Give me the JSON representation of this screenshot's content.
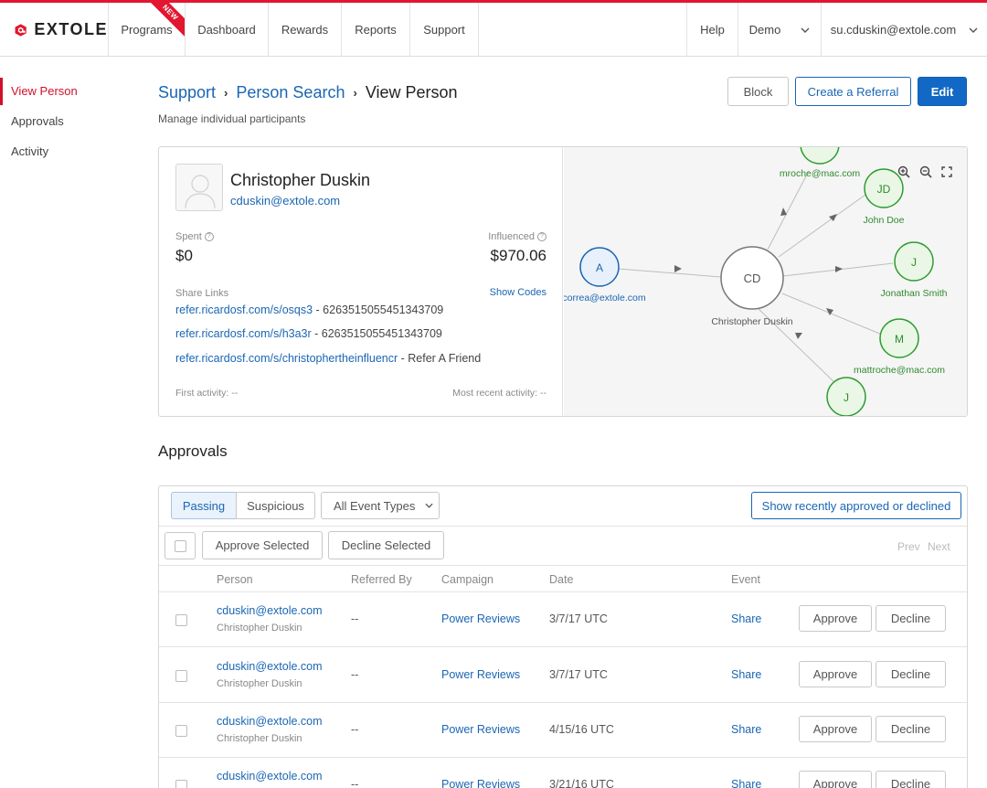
{
  "brand": {
    "name": "EXTOLE",
    "accent": "#e2162f",
    "link": "#1a66b3"
  },
  "nav": {
    "programs": "Programs",
    "new_badge": "NEW",
    "dashboard": "Dashboard",
    "rewards": "Rewards",
    "reports": "Reports",
    "support": "Support",
    "help": "Help",
    "demo": "Demo",
    "user": "su.cduskin@extole.com"
  },
  "sidebar": {
    "items": [
      {
        "label": "View Person"
      },
      {
        "label": "Approvals"
      },
      {
        "label": "Activity"
      }
    ]
  },
  "breadcrumb": {
    "items": [
      "Support",
      "Person Search"
    ],
    "current": "View Person"
  },
  "subtitle": "Manage individual participants",
  "actions": {
    "block": "Block",
    "create_referral": "Create a Referral",
    "edit": "Edit"
  },
  "person": {
    "name": "Christopher Duskin",
    "email": "cduskin@extole.com",
    "spent_label": "Spent",
    "spent_value": "$0",
    "influenced_label": "Influenced",
    "influenced_value": "$970.06",
    "share_links_label": "Share Links",
    "show_codes": "Show Codes",
    "links": [
      {
        "url": "refer.ricardosf.com/s/osqs3",
        "suffix": " - 6263515055451343709"
      },
      {
        "url": "refer.ricardosf.com/s/h3a3r",
        "suffix": " - 6263515055451343709"
      },
      {
        "url": "refer.ricardosf.com/s/christophertheinfluencr",
        "suffix": " - Refer A Friend"
      }
    ],
    "first_activity": "First activity: --",
    "recent_activity": "Most recent activity: --"
  },
  "graph": {
    "center": {
      "initials": "CD",
      "label": "Christopher Duskin"
    },
    "nodes": [
      {
        "initials": "A",
        "label": "correa@extole.com",
        "type": "referrer"
      },
      {
        "initials": "",
        "label": "mroche@mac.com",
        "type": "referred"
      },
      {
        "initials": "JD",
        "label": "John Doe",
        "type": "referred"
      },
      {
        "initials": "J",
        "label": "Jonathan Smith",
        "type": "referred"
      },
      {
        "initials": "M",
        "label": "mattroche@mac.com",
        "type": "referred"
      },
      {
        "initials": "J",
        "label": "",
        "type": "referred"
      }
    ],
    "colors": {
      "referrer_fill": "#e8f1fb",
      "referrer_stroke": "#1a66b3",
      "referred_fill": "#eaf7e6",
      "referred_stroke": "#2f9b2f",
      "referred_text": "#2f8a2f"
    }
  },
  "approvals": {
    "title": "Approvals",
    "tabs": [
      "Passing",
      "Suspicious"
    ],
    "event_filter": "All Event Types",
    "show_recent": "Show recently approved or declined",
    "approve_selected": "Approve Selected",
    "decline_selected": "Decline Selected",
    "prev": "Prev",
    "next": "Next",
    "columns": [
      "Person",
      "Referred By",
      "Campaign",
      "Date",
      "Event"
    ],
    "rows": [
      {
        "email": "cduskin@extole.com",
        "name": "Christopher Duskin",
        "referred_by": "--",
        "campaign": "Power Reviews",
        "date": "3/7/17 UTC",
        "event": "Share",
        "approve": "Approve",
        "decline": "Decline"
      },
      {
        "email": "cduskin@extole.com",
        "name": "Christopher Duskin",
        "referred_by": "--",
        "campaign": "Power Reviews",
        "date": "3/7/17 UTC",
        "event": "Share",
        "approve": "Approve",
        "decline": "Decline"
      },
      {
        "email": "cduskin@extole.com",
        "name": "Christopher Duskin",
        "referred_by": "--",
        "campaign": "Power Reviews",
        "date": "4/15/16 UTC",
        "event": "Share",
        "approve": "Approve",
        "decline": "Decline"
      },
      {
        "email": "cduskin@extole.com",
        "name": "",
        "referred_by": "--",
        "campaign": "Power Reviews",
        "date": "3/21/16 UTC",
        "event": "Share",
        "approve": "Approve",
        "decline": "Decline"
      }
    ]
  }
}
